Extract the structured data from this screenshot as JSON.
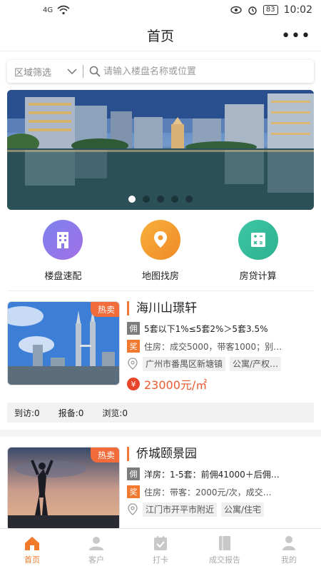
{
  "status": {
    "network": "4G",
    "battery": "83",
    "time": "10:02"
  },
  "nav": {
    "title": "首页"
  },
  "search": {
    "region_label": "区域筛选",
    "placeholder": "请输入楼盘名称或位置"
  },
  "quick_actions": [
    {
      "label": "楼盘速配",
      "color_from": "#7b84ef",
      "color_to": "#a36ee6",
      "icon": "building-icon"
    },
    {
      "label": "地图找房",
      "color_from": "#f6b03b",
      "color_to": "#f08a27",
      "icon": "map-pin-icon"
    },
    {
      "label": "房贷计算",
      "color_from": "#3ec7a5",
      "color_to": "#2eb08f",
      "icon": "calculator-icon"
    }
  ],
  "listings": [
    {
      "hot": "热卖",
      "name": "海川山璟轩",
      "badge1": "佣",
      "commission": "5套以下1%≤5套2%＞5套3.5%",
      "badge2": "奖",
      "reward": "住房：成交5000，带客1000；别…",
      "address": "广州市番禺区新塘镇",
      "type": "公寓/产权…",
      "price": "23000元/㎡",
      "yen": "¥",
      "stats": [
        "到访:0",
        "报备:0",
        "浏览:0"
      ]
    },
    {
      "hot": "热卖",
      "name": "侨城颐景园",
      "badge1": "佣",
      "commission": "洋房：1-5套：前佣41000＋后佣…",
      "badge2": "奖",
      "reward": "住房：带客：2000元/次，成交…",
      "address": "江门市开平市附近",
      "type": "公寓/住宅"
    }
  ],
  "tabs": [
    {
      "label": "首页",
      "active": true
    },
    {
      "label": "客户",
      "active": false
    },
    {
      "label": "打卡",
      "active": false
    },
    {
      "label": "成交报告",
      "active": false
    },
    {
      "label": "我的",
      "active": false
    }
  ],
  "colors": {
    "accent": "#f07a2a",
    "price": "#ea5a2f",
    "hot_tag": "#f26b3a"
  }
}
